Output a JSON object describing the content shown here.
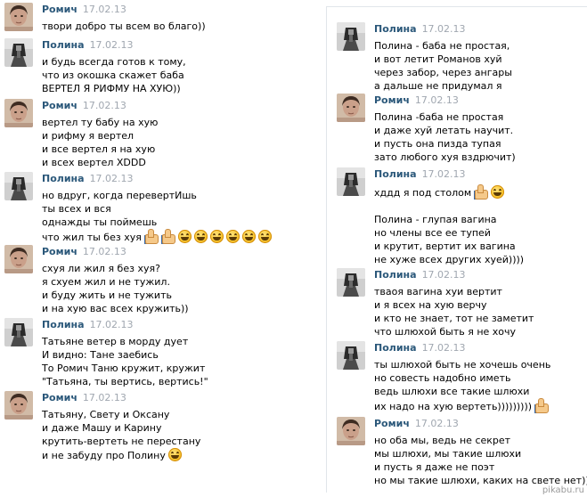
{
  "users": {
    "romich": "Ромич",
    "polina": "Полина"
  },
  "colors": {
    "name": "#2b587a",
    "date": "#a0a7b0",
    "text": "#000000"
  },
  "left_messages": [
    {
      "author": "Ромич",
      "date": "17.02.13",
      "lines": [
        "твори добро ты всем во благо))"
      ]
    },
    {
      "author": "Полина",
      "date": "17.02.13",
      "lines": [
        "и будь всегда готов к тому,",
        "что из окошка скажет баба",
        "ВЕРТЕЛ Я РИФМУ НА ХУЮ))"
      ]
    },
    {
      "author": "Ромич",
      "date": "17.02.13",
      "lines": [
        "вертел ту бабу на хую",
        "и рифму я вертел",
        "и все вертел я на хую",
        "и всех вертел XDDD"
      ]
    },
    {
      "author": "Полина",
      "date": "17.02.13",
      "lines": [
        "но вдруг, когда перевертИшь",
        "ты всех и вся",
        "однажды ты поймешь",
        "что жил ты без хуя"
      ],
      "emoji": [
        "thumbs-up",
        "thumbs-up",
        "laugh",
        "laugh",
        "laugh",
        "laugh",
        "laugh",
        "laugh"
      ]
    },
    {
      "author": "Ромич",
      "date": "17.02.13",
      "lines": [
        "схуя ли жил я без хуя?",
        "я схуем жил и не тужил.",
        "и буду жить и не тужить",
        "и на хую вас всех кружить))"
      ]
    },
    {
      "author": "Полина",
      "date": "17.02.13",
      "lines": [
        "Татьяне ветер в морду дует",
        "И видно: Тане заебись",
        "То Ромич Таню кружит, кружит",
        "\"Татьяна, ты вертись, вертись!\""
      ]
    },
    {
      "author": "Ромич",
      "date": "17.02.13",
      "lines": [
        "Татьяну, Свету и Оксану",
        "и даже Машу и Карину",
        "крутить-вертеть не перестану",
        "и не забуду про Полину"
      ],
      "emoji": [
        "laugh"
      ]
    }
  ],
  "right_messages": [
    {
      "author": "Полина",
      "date": "17.02.13",
      "lines": [
        "Полина - баба не простая,",
        "и вот летит Романов хуй",
        "через забор, через ангары",
        "а дальше не придумал я"
      ]
    },
    {
      "author": "Ромич",
      "date": "17.02.13",
      "lines": [
        "Полина -баба не простая",
        "и даже хуй летать научит.",
        "и пусть она пизда тупая",
        "зато любого хуя вздрючит)"
      ]
    },
    {
      "author": "Полина",
      "date": "17.02.13",
      "lines": [
        "хддд я под столом",
        "",
        "Полина - глупая вагина",
        "но члены все ее тупей",
        "и крутит, вертит их вагина",
        "не хуже всех других хуей))))"
      ],
      "emoji_line0": [
        "thumbs-up",
        "laugh"
      ]
    },
    {
      "author": "Полина",
      "date": "17.02.13",
      "lines": [
        "тваоя вагина хуи вертит",
        "и я всех на хую верчу",
        "и кто не знает, тот не заметит",
        "что шлюхой быть я не хочу"
      ]
    },
    {
      "author": "Полина",
      "date": "17.02.13",
      "lines": [
        "ты шлюхой быть не хочешь очень",
        "но совесть надобно иметь",
        "ведь шлюхи все такие шлюхи",
        "их надо на хую вертеть)))))))))"
      ],
      "emoji": [
        "thumbs-up"
      ]
    },
    {
      "author": "Ромич",
      "date": "17.02.13",
      "lines": [
        "но оба мы, ведь не секрет",
        "мы шлюхи, мы такие шлюхи",
        "и пусть я даже не поэт",
        "но мы такие шлюхи, каких на свете нет))"
      ]
    }
  ],
  "watermark": "pikabu.ru"
}
